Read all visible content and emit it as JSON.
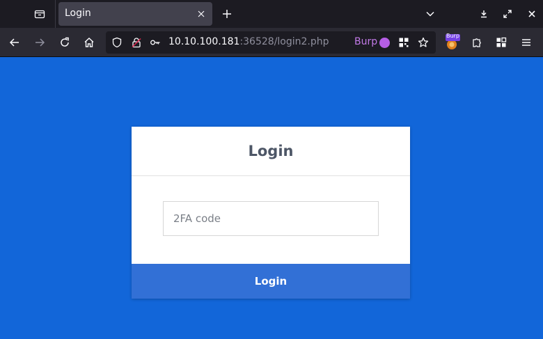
{
  "browser": {
    "tab": {
      "title": "Login"
    },
    "url": {
      "host": "10.10.100.181",
      "rest": ":36528/login2.php"
    },
    "burp": {
      "label": "Burp"
    },
    "extension_badge": "Burp",
    "icons": {
      "tab_list": "tab-list-icon",
      "tab_close": "close-icon",
      "new_tab": "plus-icon",
      "list_all_tabs": "chevron-down-icon",
      "download": "download-icon",
      "restore": "restore-icon",
      "window_close": "close-icon",
      "back": "back-arrow-icon",
      "forward": "forward-arrow-icon",
      "reload": "reload-icon",
      "home": "home-icon",
      "shield": "shield-icon",
      "insecure_lock": "insecure-lock-icon",
      "key": "key-icon",
      "grid": "grid-icon",
      "star": "star-icon",
      "extensions": "puzzle-icon",
      "apps": "apps-icon",
      "menu": "hamburger-menu-icon"
    }
  },
  "page": {
    "background_color": "#1266d9",
    "card": {
      "title": "Login",
      "code_placeholder": "2FA code",
      "code_value": "",
      "submit_label": "Login",
      "button_color": "#3270d6"
    }
  }
}
